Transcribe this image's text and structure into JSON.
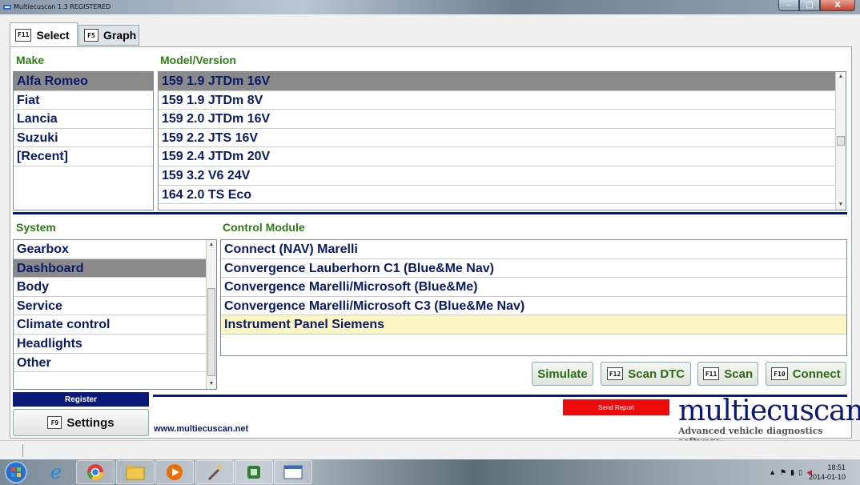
{
  "window": {
    "title": "Multiecuscan 1.3 REGISTERED",
    "close_glyph": "X",
    "min_glyph": "–",
    "max_glyph": "□"
  },
  "tabs": [
    {
      "key": "F11",
      "label": "Select",
      "active": true
    },
    {
      "key": "F5",
      "label": "Graph",
      "active": false
    }
  ],
  "make": {
    "header": "Make",
    "items": [
      "Alfa Romeo",
      "Fiat",
      "Lancia",
      "Suzuki",
      "[Recent]"
    ],
    "selected": 0
  },
  "model": {
    "header": "Model/Version",
    "items": [
      "159 1.9 JTDm 16V",
      "159 1.9 JTDm 8V",
      "159 2.0 JTDm 16V",
      "159 2.2 JTS 16V",
      "159 2.4 JTDm 20V",
      "159 3.2 V6 24V",
      "164 2.0 TS Eco"
    ],
    "selected": 0
  },
  "system": {
    "header": "System",
    "items": [
      "Gearbox",
      "Dashboard",
      "Body",
      "Service",
      "Climate control",
      "Headlights",
      "Other"
    ],
    "selected": 1
  },
  "control_module": {
    "header": "Control Module",
    "items": [
      "Connect (NAV) Marelli",
      "Convergence Lauberhorn C1 (Blue&Me Nav)",
      "Convergence Marelli/Microsoft (Blue&Me)",
      "Convergence Marelli/Microsoft C3 (Blue&Me Nav)",
      "Instrument Panel Siemens"
    ],
    "highlighted": 4
  },
  "actions": {
    "simulate": "Simulate",
    "scan_dtc_key": "F12",
    "scan_dtc": "Scan DTC",
    "scan_key": "F11",
    "scan": "Scan",
    "connect_key": "F10",
    "connect": "Connect"
  },
  "footer": {
    "register": "Register",
    "settings_key": "F9",
    "settings": "Settings",
    "website": "www.multiecuscan.net",
    "send_report": "Send Report",
    "logo": "multiecuscan",
    "tagline": "Advanced vehicle diagnostics software"
  },
  "taskbar": {
    "time": "18:51",
    "date": "2014-01-10",
    "apps": [
      "internet-explorer-icon",
      "chrome-icon",
      "file-explorer-icon",
      "media-player-icon",
      "tool-icon",
      "app-icon",
      "window-app-icon"
    ]
  },
  "colors": {
    "accent_navy": "#0b1a78",
    "header_green": "#2e7d14",
    "selection_gray": "#8a8a8a",
    "highlight_yellow": "#fbf6c2",
    "send_red": "#ee0a0a"
  }
}
